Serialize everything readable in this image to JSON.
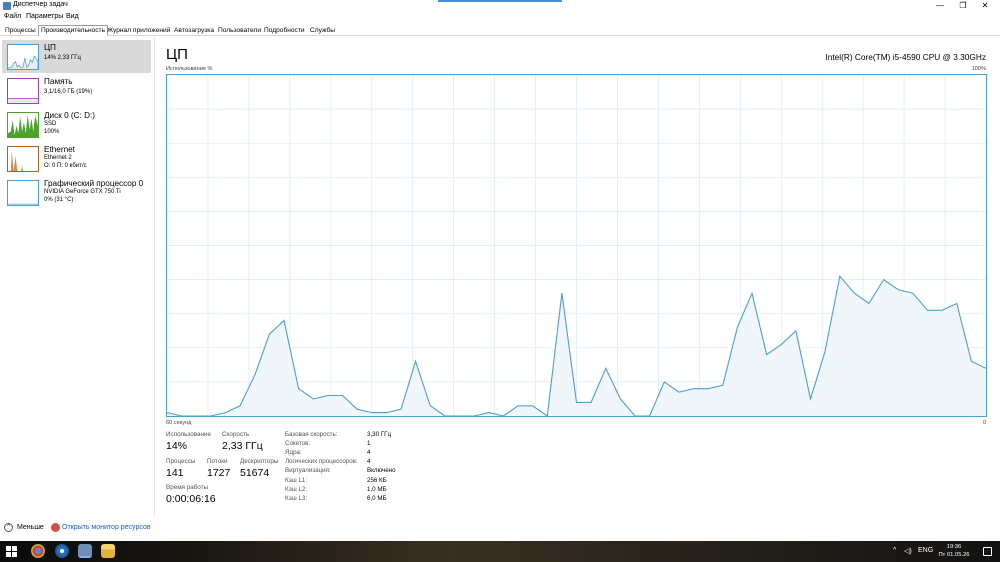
{
  "window": {
    "title": "Диспетчер задач",
    "minimize_glyph": "—",
    "restore_glyph": "❐",
    "close_glyph": "✕"
  },
  "menu": [
    "Файл",
    "Параметры",
    "Вид"
  ],
  "tabs": [
    {
      "label": "Процессы",
      "active": false
    },
    {
      "label": "Производительность",
      "active": true
    },
    {
      "label": "Журнал приложений",
      "active": false
    },
    {
      "label": "Автозагрузка",
      "active": false
    },
    {
      "label": "Пользователи",
      "active": false
    },
    {
      "label": "Подробности",
      "active": false
    },
    {
      "label": "Службы",
      "active": false
    }
  ],
  "sidebar": {
    "items": [
      {
        "name": "ЦП",
        "line1": "14% 2,33 ГГц",
        "line2": "",
        "line3": "",
        "color": "#4d9fcf",
        "selected": true
      },
      {
        "name": "Память",
        "line1": "3,1/16,0 ГБ (19%)",
        "line2": "",
        "line3": "",
        "color": "#9b42b8",
        "selected": false
      },
      {
        "name": "Диск 0 (C: D:)",
        "line1": "SSD",
        "line2": "100%",
        "line3": "",
        "color": "#4ca22b",
        "selected": false
      },
      {
        "name": "Ethernet",
        "line1": "Ethernet 2",
        "line2": "О: 0 П: 0 кбит/с",
        "line3": "",
        "color": "#a7631f",
        "selected": false
      },
      {
        "name": "Графический процессор 0",
        "line1": "NVIDIA GeForce GTX 750 Ti",
        "line2": "0% (31 °C)",
        "line3": "",
        "color": "#4d9fcf",
        "selected": false
      }
    ]
  },
  "main": {
    "title": "ЦП",
    "cpu_model": "Intel(R) Core(TM) i5-4590 CPU @ 3.30GHz",
    "axis_label_top_left": "Использование %",
    "axis_label_top_right": "100%",
    "axis_label_bottom_left": "60 секунд",
    "axis_label_bottom_right": "0"
  },
  "stats": {
    "usage_label": "Использование",
    "usage_value": "14%",
    "speed_label": "Скорость",
    "speed_value": "2,33 ГГц",
    "processes_label": "Процессы",
    "processes_value": "141",
    "threads_label": "Потоки",
    "threads_value": "1727",
    "handles_label": "Дескрипторы",
    "handles_value": "51674",
    "uptime_label": "Время работы",
    "uptime_value": "0:00:06:16"
  },
  "specs": [
    {
      "label": "Базовая скорость:",
      "value": "3,30 ГГц"
    },
    {
      "label": "Сокетов:",
      "value": "1"
    },
    {
      "label": "Ядра:",
      "value": "4"
    },
    {
      "label": "Логических процессоров:",
      "value": "4"
    },
    {
      "label": "Виртуализация:",
      "value": "Включено"
    },
    {
      "label": "Кэш L1:",
      "value": "256 КБ"
    },
    {
      "label": "Кэш L2:",
      "value": "1,0 МБ"
    },
    {
      "label": "Кэш L3:",
      "value": "6,0 МБ"
    }
  ],
  "footer": {
    "less_label": "Меньше",
    "less_glyph": "^",
    "resource_monitor_label": "Открыть монитор ресурсов"
  },
  "taskbar": {
    "tray_up": "^",
    "tray_lang": "ENG",
    "time": "19:36",
    "date": "Пт 01.05.26"
  },
  "colors": {
    "cpu_line": "#4d9fcf",
    "cpu_fill": "#f1f6fa",
    "grid": "#d9eaf4"
  },
  "chart_data": {
    "type": "area",
    "title": "",
    "xlabel": "60 секунд",
    "ylabel": "Использование %",
    "xlim": [
      60,
      0
    ],
    "ylim": [
      0,
      100
    ],
    "grid": true,
    "series": [
      {
        "values": [
          1,
          0,
          0,
          0,
          1,
          3,
          12,
          24,
          28,
          8,
          5,
          6,
          6,
          2,
          1,
          1,
          2,
          16,
          3,
          0,
          0,
          0,
          1,
          0,
          3,
          3,
          0,
          36,
          4,
          4,
          14,
          5,
          0,
          0,
          10,
          7,
          8,
          8,
          9,
          26,
          36,
          18,
          21,
          25,
          5,
          19,
          41,
          36,
          33,
          40,
          37,
          36,
          31,
          31,
          33,
          16,
          14
        ]
      }
    ]
  }
}
